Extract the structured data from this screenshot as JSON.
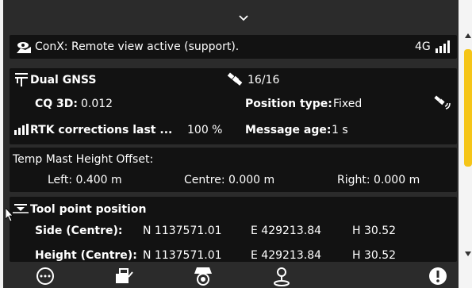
{
  "remote_banner": {
    "text": "ConX: Remote view active (support).",
    "network": "4G"
  },
  "gnss": {
    "title": "Dual GNSS",
    "satellites": "16/16",
    "cq3d_label": "CQ 3D:",
    "cq3d_value": "0.012",
    "position_type_label": "Position type:",
    "position_type_value": "Fixed",
    "rtk_label": "RTK corrections last ...",
    "rtk_value": "100 %",
    "message_age_label": "Message age:",
    "message_age_value": "1 s"
  },
  "mast": {
    "title": "Temp Mast Height Offset:",
    "left": "Left: 0.400 m",
    "centre": "Centre: 0.000 m",
    "right": "Right: 0.000 m"
  },
  "tool_point": {
    "title": "Tool point position",
    "rows": [
      {
        "label": "Side (Centre):",
        "n": "N 1137571.01",
        "e": "E 429213.84",
        "h": "H 30.52"
      },
      {
        "label": "Height (Centre):",
        "n": "N 1137571.01",
        "e": "E 429213.84",
        "h": "H 30.52"
      }
    ]
  },
  "colors": {
    "accent": "#f5c518",
    "panel": "#2b2b2b",
    "card": "#121212"
  },
  "icons": [
    "chevron-down-icon",
    "remote-view-icon",
    "signal-icon",
    "gnss-antenna-icon",
    "satellite-icon",
    "fix-icon",
    "rtk-signal-icon",
    "tool-point-icon",
    "menu-icon",
    "machine-icon",
    "camera-icon",
    "location-icon",
    "alert-icon"
  ]
}
